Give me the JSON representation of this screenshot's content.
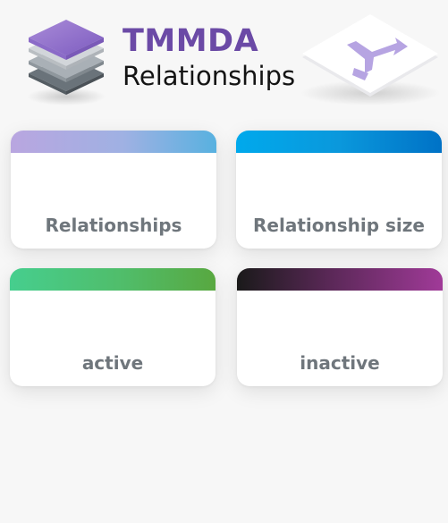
{
  "header": {
    "app_title": "TMMDA",
    "page_title": "Relationships",
    "logo_icon": "layers-stack-icon",
    "nav_icon": "relationship-arrows-icon"
  },
  "colors": {
    "title_purple": "#6b4aa6",
    "label_gray": "#6f767c",
    "card1_gradient": [
      "#b9a6e0",
      "#58b1e0"
    ],
    "card2_gradient": [
      "#00a9ec",
      "#0072c6"
    ],
    "card3_gradient": [
      "#46ce8e",
      "#58a840"
    ],
    "card4_gradient": [
      "#1a1a1a",
      "#a03a98"
    ]
  },
  "cards": [
    {
      "label": "Relationships"
    },
    {
      "label": "Relationship size"
    },
    {
      "label": "active"
    },
    {
      "label": "inactive"
    }
  ]
}
